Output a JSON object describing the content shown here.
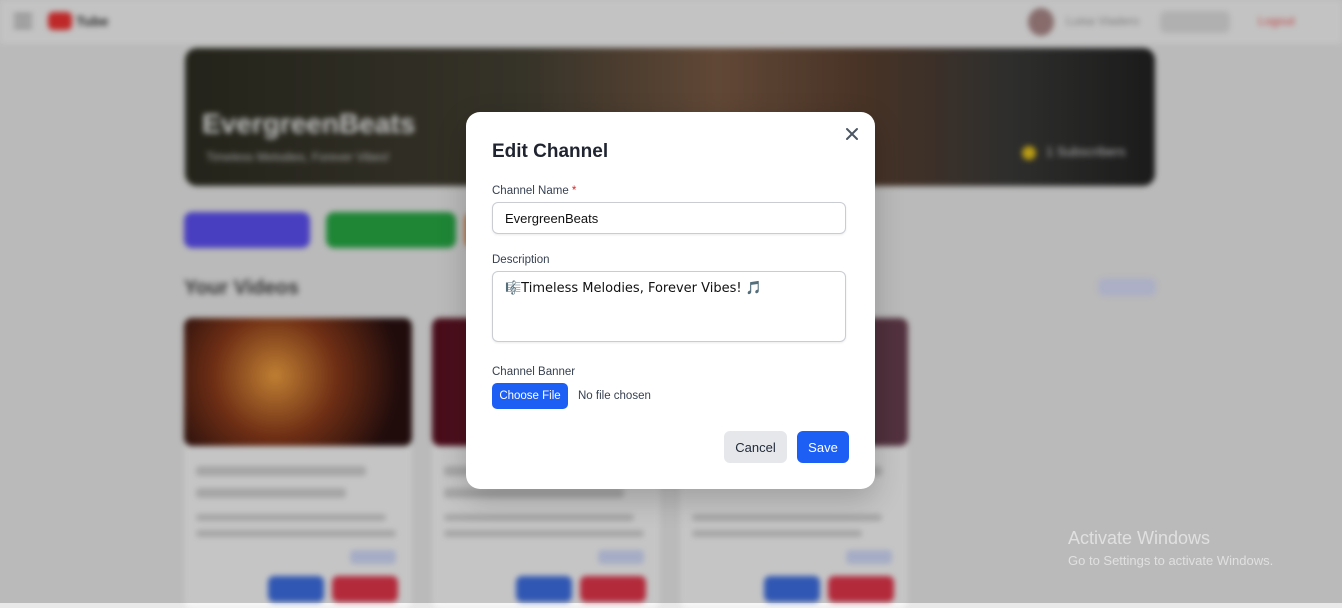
{
  "background": {
    "logo_text": "Tube",
    "user_name": "Luisa Viadero",
    "logout_label": "Logout",
    "channel_title": "EvergreenBeats",
    "channel_sub": "Timeless Melodies, Forever Vibes!",
    "subscribers": "1 Subscribers",
    "section_title": "Your Videos"
  },
  "modal": {
    "title": "Edit Channel",
    "close_icon": "close-icon",
    "channel_name_label": "Channel Name",
    "required_mark": "*",
    "channel_name_value": "EvergreenBeats",
    "description_label": "Description",
    "description_value": "🎼Timeless Melodies, Forever Vibes! 🎵",
    "banner_label": "Channel Banner",
    "choose_file_label": "Choose File",
    "file_status": "No file chosen",
    "cancel_label": "Cancel",
    "save_label": "Save"
  },
  "system": {
    "watermark_title": "Activate Windows",
    "watermark_sub": "Go to Settings to activate Windows."
  },
  "colors": {
    "primary": "#1d5ef5",
    "cancel_bg": "#e5e7eb",
    "required": "#dc2626"
  }
}
